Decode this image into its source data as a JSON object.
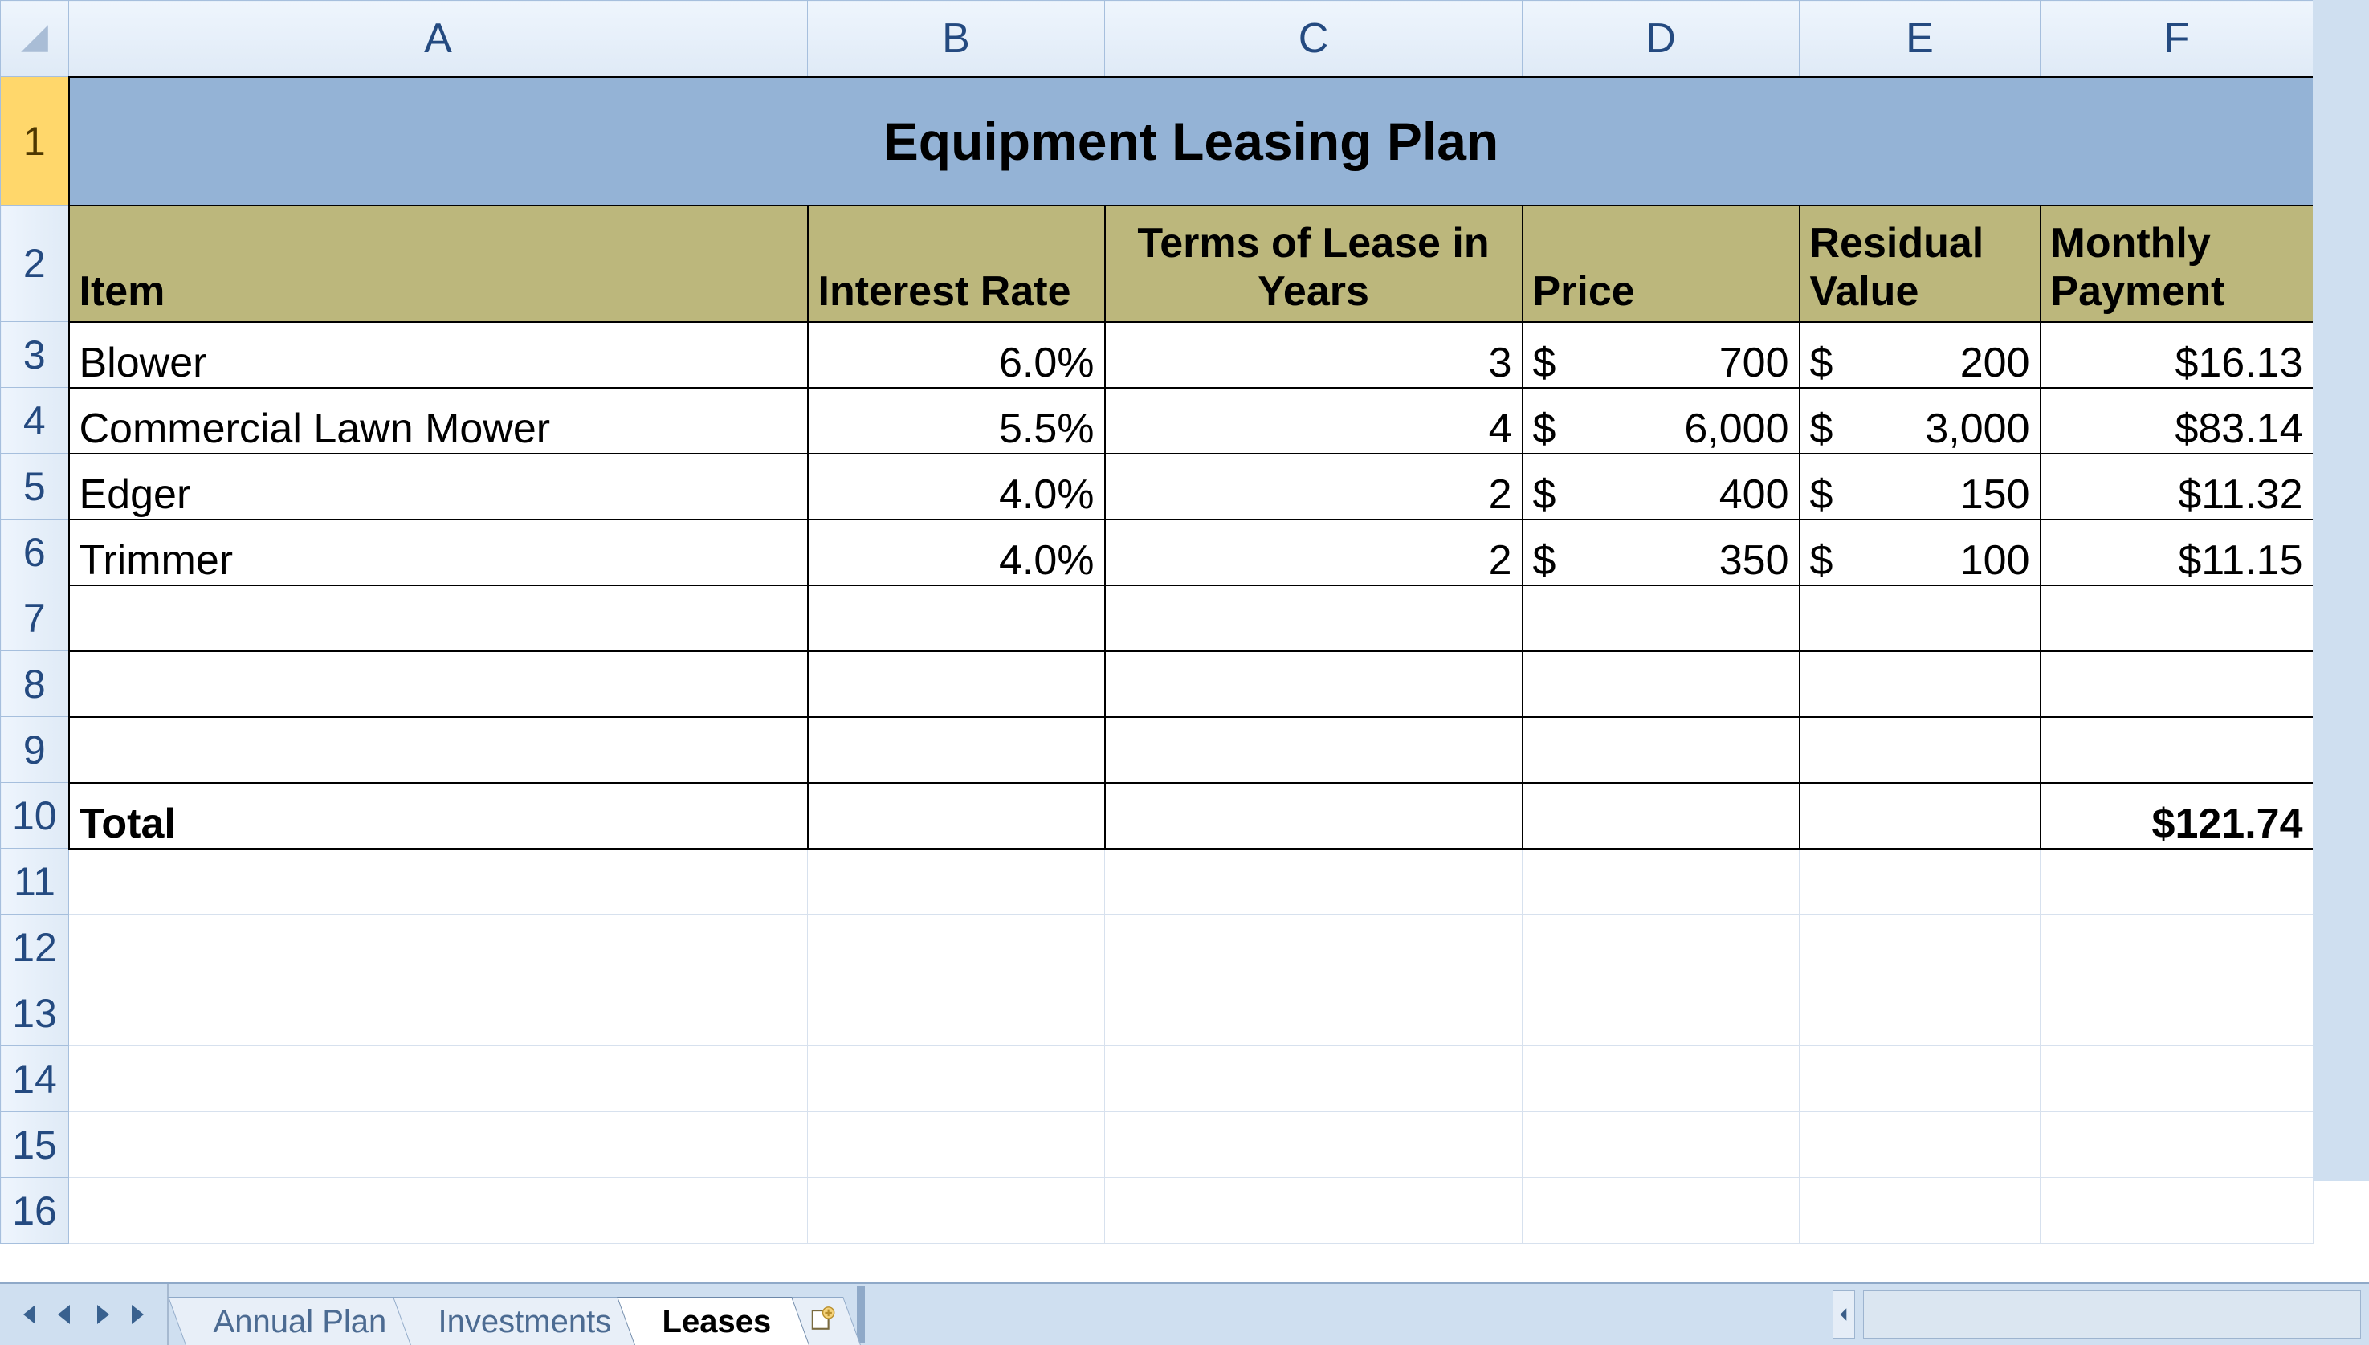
{
  "columns": [
    "A",
    "B",
    "C",
    "D",
    "E",
    "F"
  ],
  "row_numbers": [
    "1",
    "2",
    "3",
    "4",
    "5",
    "6",
    "7",
    "8",
    "9",
    "10",
    "11",
    "12",
    "13",
    "14",
    "15",
    "16"
  ],
  "title": "Equipment Leasing Plan",
  "headers": {
    "item": "Item",
    "rate": "Interest Rate",
    "terms": "Terms of Lease in Years",
    "price": "Price",
    "residual": "Residual Value",
    "payment": "Monthly Payment"
  },
  "rows": [
    {
      "item": "Blower",
      "rate": "6.0%",
      "terms": "3",
      "price_sym": "$",
      "price": "700",
      "resid_sym": "$",
      "resid": "200",
      "pay": "$16.13"
    },
    {
      "item": "Commercial Lawn Mower",
      "rate": "5.5%",
      "terms": "4",
      "price_sym": "$",
      "price": "6,000",
      "resid_sym": "$",
      "resid": "3,000",
      "pay": "$83.14"
    },
    {
      "item": "Edger",
      "rate": "4.0%",
      "terms": "2",
      "price_sym": "$",
      "price": "400",
      "resid_sym": "$",
      "resid": "150",
      "pay": "$11.32"
    },
    {
      "item": "Trimmer",
      "rate": "4.0%",
      "terms": "2",
      "price_sym": "$",
      "price": "350",
      "resid_sym": "$",
      "resid": "100",
      "pay": "$11.15"
    }
  ],
  "total": {
    "label": "Total",
    "pay": "$121.74"
  },
  "tabs": {
    "items": [
      "Annual Plan",
      "Investments",
      "Leases"
    ],
    "active": "Leases"
  },
  "chart_data": {
    "type": "table",
    "title": "Equipment Leasing Plan",
    "columns": [
      "Item",
      "Interest Rate",
      "Terms of Lease in Years",
      "Price",
      "Residual Value",
      "Monthly Payment"
    ],
    "rows": [
      [
        "Blower",
        0.06,
        3,
        700,
        200,
        16.13
      ],
      [
        "Commercial Lawn Mower",
        0.055,
        4,
        6000,
        3000,
        83.14
      ],
      [
        "Edger",
        0.04,
        2,
        400,
        150,
        11.32
      ],
      [
        "Trimmer",
        0.04,
        2,
        350,
        100,
        11.15
      ]
    ],
    "totals": {
      "Monthly Payment": 121.74
    }
  }
}
